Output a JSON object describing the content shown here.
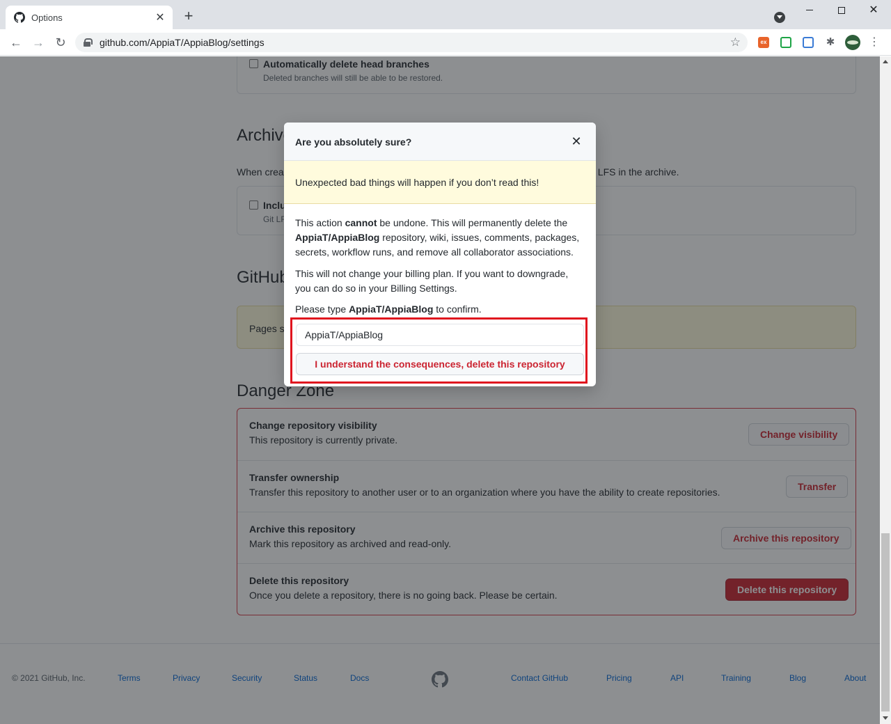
{
  "browser": {
    "tab_title": "Options",
    "url": "github.com/AppiaT/AppiaBlog/settings",
    "tab_close": "✕",
    "new_tab": "+"
  },
  "settings": {
    "auto_delete_label": "Automatically delete head branches",
    "auto_delete_note": "Deleted branches will still be able to be restored.",
    "archives_heading": "Archives",
    "archives_desc_start": "When creat",
    "archives_desc_end": "t LFS in the archive.",
    "include_label_partial": "Inclu",
    "include_note_partial": "Git LF",
    "pages_heading": "GitHub",
    "pages_flash_partial": "Pages se",
    "danger_heading": "Danger Zone"
  },
  "danger_zone": {
    "rows": [
      {
        "title": "Change repository visibility",
        "desc": "This repository is currently private.",
        "button": "Change visibility"
      },
      {
        "title": "Transfer ownership",
        "desc": "Transfer this repository to another user or to an organization where you have the ability to create repositories.",
        "button": "Transfer"
      },
      {
        "title": "Archive this repository",
        "desc": "Mark this repository as archived and read-only.",
        "button": "Archive this repository"
      },
      {
        "title": "Delete this repository",
        "desc": "Once you delete a repository, there is no going back. Please be certain.",
        "button": "Delete this repository"
      }
    ]
  },
  "modal": {
    "title": "Are you absolutely sure?",
    "close": "✕",
    "warning": "Unexpected bad things will happen if you don’t read this!",
    "p1_a": "This action ",
    "p1_b": "cannot",
    "p1_c": " be undone. This will permanently delete the ",
    "p1_d": "AppiaT/AppiaBlog",
    "p1_e": " repository, wiki, issues, comments, packages, secrets, workflow runs, and remove all collaborator associations.",
    "p2": "This will not change your billing plan. If you want to downgrade, you can do so in your Billing Settings.",
    "p3_a": "Please type ",
    "p3_b": "AppiaT/AppiaBlog",
    "p3_c": " to confirm.",
    "input_value": "AppiaT/AppiaBlog",
    "confirm_button": "I understand the consequences, delete this repository"
  },
  "footer": {
    "copyright": "© 2021 GitHub, Inc.",
    "left_links": [
      "Terms",
      "Privacy",
      "Security",
      "Status",
      "Docs"
    ],
    "right_links": [
      "Contact GitHub",
      "Pricing",
      "API",
      "Training",
      "Blog",
      "About"
    ]
  },
  "colors": {
    "danger": "#cb2431",
    "link": "#0366d6",
    "highlight": "#e0141e"
  }
}
